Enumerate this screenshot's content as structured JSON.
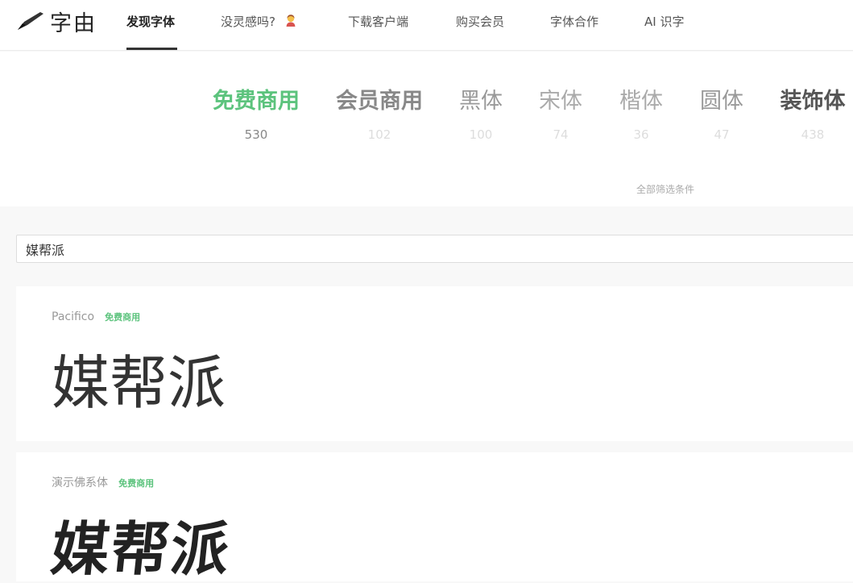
{
  "logo": {
    "text": "字由",
    "icon": "brush-pen-icon"
  },
  "nav": [
    {
      "label": "发现字体",
      "active": true
    },
    {
      "label": "没灵感吗?",
      "icon": "person-emoji-icon"
    },
    {
      "label": "下载客户端"
    },
    {
      "label": "购买会员"
    },
    {
      "label": "字体合作"
    },
    {
      "label": "AI 识字"
    }
  ],
  "categories": [
    {
      "label": "免费商用",
      "count": "530"
    },
    {
      "label": "会员商用",
      "count": "102"
    },
    {
      "label": "黑体",
      "count": "100"
    },
    {
      "label": "宋体",
      "count": "74"
    },
    {
      "label": "楷体",
      "count": "36"
    },
    {
      "label": "圆体",
      "count": "47"
    },
    {
      "label": "装饰体",
      "count": "438"
    }
  ],
  "filter_link": "全部筛选条件",
  "preview_input": {
    "value": "媒帮派"
  },
  "fonts": [
    {
      "name": "Pacifico",
      "badge": "免费商用",
      "sample": "媒帮派"
    },
    {
      "name": "演示佛系体",
      "badge": "免费商用",
      "sample": "媒帮派"
    }
  ],
  "colors": {
    "accent": "#5cc37d",
    "text": "#333333",
    "muted": "#999999"
  }
}
